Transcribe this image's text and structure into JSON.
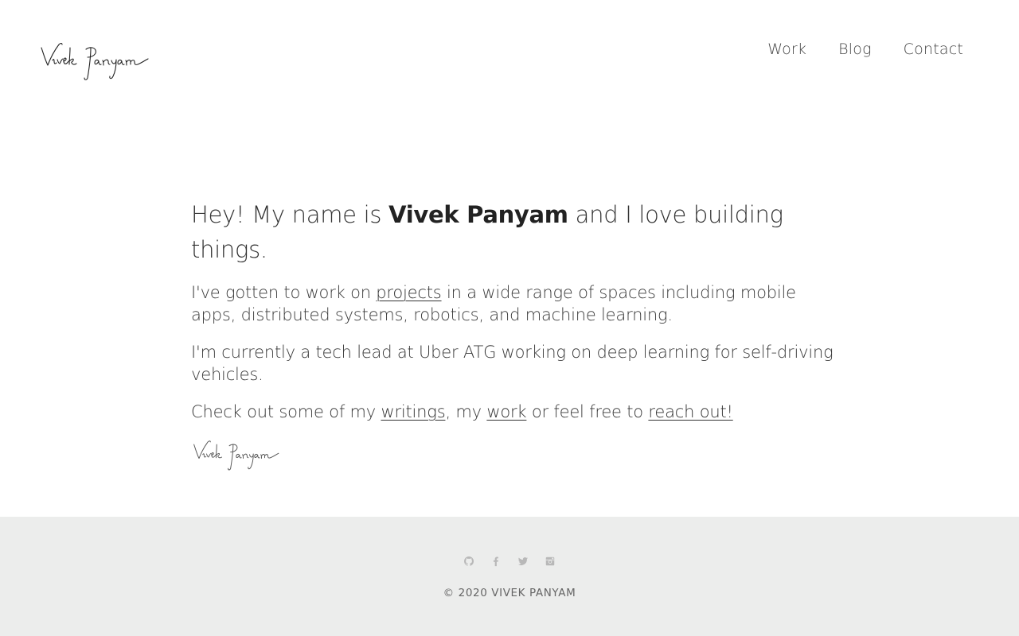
{
  "header": {
    "logo_alt": "Vivek Panyam signature logo",
    "nav": [
      {
        "label": "Work"
      },
      {
        "label": "Blog"
      },
      {
        "label": "Contact"
      }
    ]
  },
  "main": {
    "headline": {
      "prefix": "Hey! My name is ",
      "name": "Vivek Panyam",
      "suffix": " and I love building things."
    },
    "para1": {
      "before": "I've gotten to work on ",
      "link": "projects",
      "after": " in a wide range of spaces including mobile apps, distributed systems, robotics, and machine learning."
    },
    "para2": {
      "text": "I'm currently a tech lead at Uber ATG working on deep learning for self-driving vehicles."
    },
    "para3": {
      "before": "Check out some of my ",
      "link1": "writings",
      "mid1": ", my ",
      "link2": "work",
      "mid2": " or feel free to ",
      "link3": "reach out!"
    }
  },
  "footer": {
    "social": [
      {
        "icon": "github-icon"
      },
      {
        "icon": "facebook-icon"
      },
      {
        "icon": "twitter-icon"
      },
      {
        "icon": "instagram-icon"
      }
    ],
    "copyright": "© 2020 VIVEK PANYAM"
  },
  "colors": {
    "footer_bg": "#ecedec",
    "text": "#333333",
    "icon": "#b8b8b8"
  }
}
